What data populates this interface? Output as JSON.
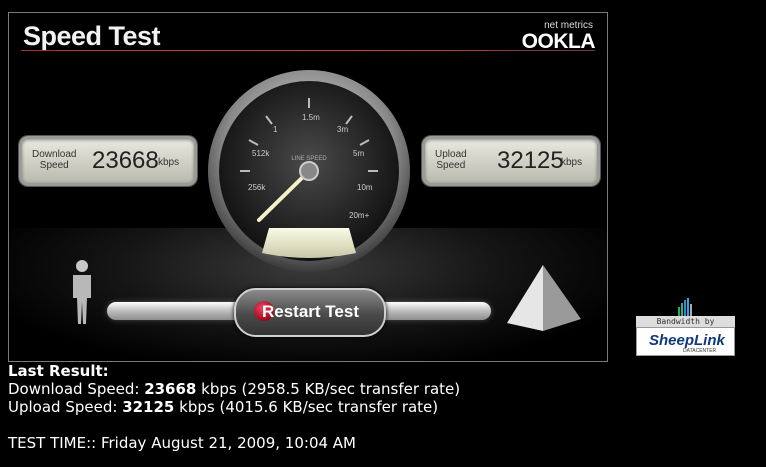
{
  "applet": {
    "title": "Speed Test",
    "logo_small": "net metrics",
    "logo_big": "OOKLA"
  },
  "gauge": {
    "center_label": "LINE SPEED",
    "ticks": [
      "256k",
      "512k",
      "1",
      "1.5m",
      "3m",
      "5m",
      "10m",
      "20m+"
    ]
  },
  "download": {
    "label_line1": "Download",
    "label_line2": "Speed",
    "value": "23668",
    "unit": "kbps"
  },
  "upload": {
    "label_line1": "Upload",
    "label_line2": "Speed",
    "value": "32125",
    "unit": "kbps"
  },
  "restart_label": "Restart Test",
  "badge": {
    "top_text": "Bandwidth by",
    "name": "SheepLink",
    "sub": "DATACENTER"
  },
  "results": {
    "heading": "Last Result:",
    "download_prefix": "Download Speed:",
    "download_value": "23668",
    "download_suffix": "kbps (2958.5 KB/sec transfer rate)",
    "upload_prefix": "Upload Speed:",
    "upload_value": "32125",
    "upload_suffix": "kbps (4015.6 KB/sec transfer rate)",
    "test_time": "TEST TIME:: Friday August 21, 2009, 10:04 AM"
  },
  "colors": {
    "background": "#000000",
    "title_rule": "#c44444",
    "restart_dot": "#cc2244",
    "badge_text": "#123a7a"
  }
}
